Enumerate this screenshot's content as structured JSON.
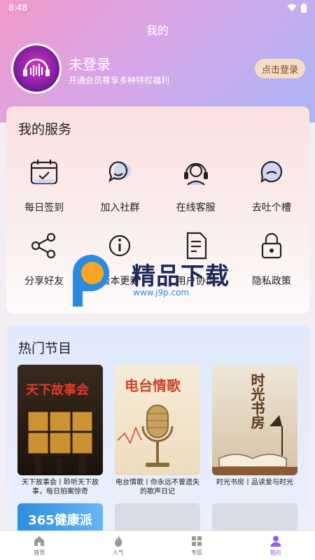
{
  "status_bar": {
    "time": "8:48"
  },
  "header": {
    "title": "我的"
  },
  "profile": {
    "name": "未登录",
    "subtitle": "开通会员尊享多种特权福利",
    "login_button": "点击登录"
  },
  "services": {
    "title": "我的服务",
    "items": [
      {
        "label": "每日签到",
        "icon": "calendar-check-icon"
      },
      {
        "label": "加入社群",
        "icon": "chat-bubbles-icon"
      },
      {
        "label": "在线客服",
        "icon": "headset-icon"
      },
      {
        "label": "去吐个槽",
        "icon": "feedback-icon"
      },
      {
        "label": "分享好友",
        "icon": "share-icon"
      },
      {
        "label": "版本更新",
        "icon": "info-icon"
      },
      {
        "label": "用户协议",
        "icon": "document-icon"
      },
      {
        "label": "隐私政策",
        "icon": "lock-icon"
      }
    ]
  },
  "watermark": {
    "text": "精品下载",
    "url": "www.j9p.com"
  },
  "hot": {
    "title": "热门节目",
    "programs": [
      {
        "caption": "天下故事会丨聆听天下故事，每日拍案惊奇",
        "cover_text": "天下故事会"
      },
      {
        "caption": "电台情歌丨你永远不曾遗失的歌声日记",
        "cover_text": "电台情歌"
      },
      {
        "caption": "时光书房丨品读爱与时光",
        "cover_text": "时光书房"
      }
    ],
    "second_row": [
      {
        "cover_text": "365健康派"
      }
    ]
  },
  "tabbar": {
    "tabs": [
      {
        "label": "首页",
        "icon": "home-icon"
      },
      {
        "label": "人气",
        "icon": "fire-icon"
      },
      {
        "label": "专区",
        "icon": "grid-icon"
      },
      {
        "label": "我的",
        "icon": "user-icon",
        "active": true
      }
    ]
  },
  "colors": {
    "accent": "#8b5cf6",
    "login_bg": "#f4dcc7"
  }
}
